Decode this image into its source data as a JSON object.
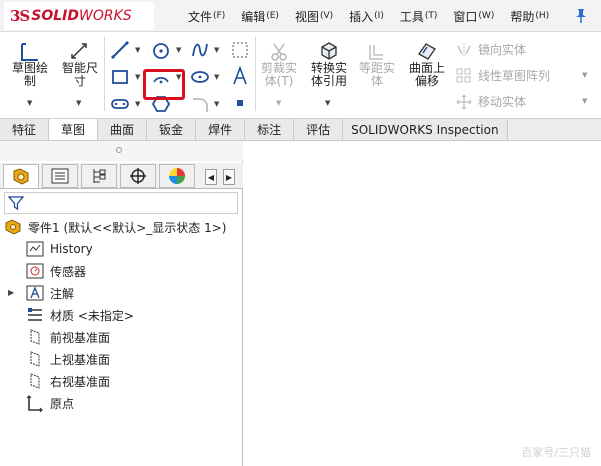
{
  "app": {
    "brand_prefix": "3S",
    "brand_bold": "SOLID",
    "brand_light": "WORKS"
  },
  "menu": [
    {
      "label": "文件",
      "acc": "(F)"
    },
    {
      "label": "编辑",
      "acc": "(E)"
    },
    {
      "label": "视图",
      "acc": "(V)"
    },
    {
      "label": "插入",
      "acc": "(I)"
    },
    {
      "label": "工具",
      "acc": "(T)"
    },
    {
      "label": "窗口",
      "acc": "(W)"
    },
    {
      "label": "帮助",
      "acc": "(H)"
    }
  ],
  "ribbon": {
    "sketch_line1": "草图绘",
    "sketch_line2": "制",
    "dimension_line1": "智能尺",
    "dimension_line2": "寸",
    "trim_line1": "剪裁实",
    "trim_line2": "体(T)",
    "convert_line1": "转换实",
    "convert_line2": "体引用",
    "offset_line1": "等距实",
    "offset_line2": "体",
    "surface_offset_line1": "曲面上",
    "surface_offset_line2": "偏移",
    "mirror": "镜向实体",
    "linear_pattern": "线性草图阵列",
    "move": "移动实体"
  },
  "tabs": [
    "特征",
    "草图",
    "曲面",
    "钣金",
    "焊件",
    "标注",
    "评估",
    "SOLIDWORKS Inspection"
  ],
  "active_tab": "草图",
  "tree": {
    "part": "零件1  (默认<<默认>_显示状态 1>)",
    "history": "History",
    "sensors": "传感器",
    "annotations": "注解",
    "material": "材质 <未指定>",
    "front_plane": "前视基准面",
    "top_plane": "上视基准面",
    "right_plane": "右视基准面",
    "origin": "原点"
  },
  "watermark": "百家号/三只猫",
  "colors": {
    "brand_red": "#c8102e",
    "highlight_red": "#d9101e",
    "icon_blue": "#1f4e9a",
    "feature_yellow": "#e8a817"
  }
}
